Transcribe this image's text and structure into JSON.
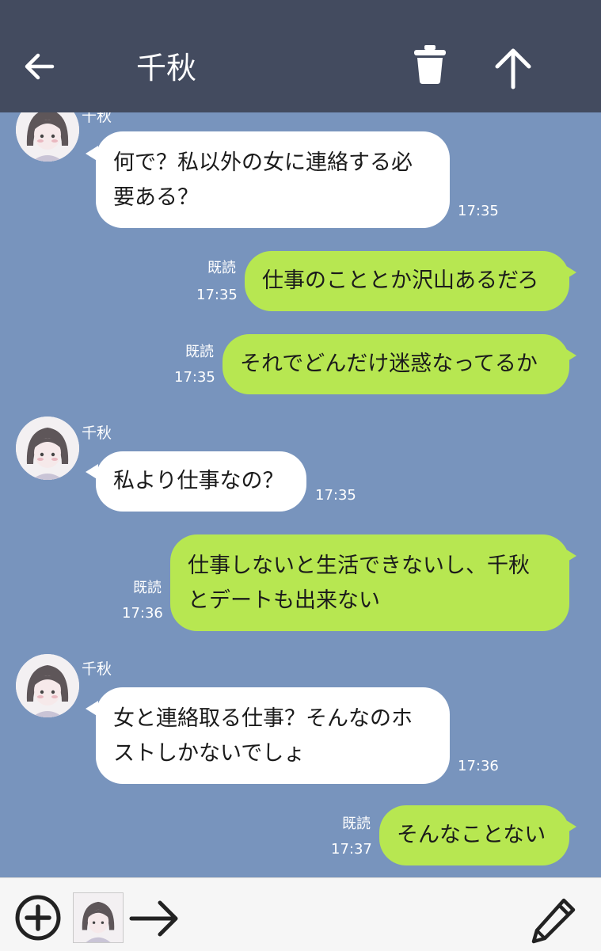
{
  "header": {
    "title": "千秋",
    "background": "#434b5f",
    "icons": [
      "back-arrow-icon",
      "trash-icon",
      "up-arrow-icon"
    ]
  },
  "chat": {
    "background": "#7894bd",
    "outgoing_color": "#b7e751",
    "incoming_color": "#ffffff",
    "messages": [
      {
        "direction": "in",
        "sender": "千秋",
        "text": "何で？私以外の女に連絡する必\n要ある？",
        "time": "17:35"
      },
      {
        "direction": "out",
        "read": "既読",
        "text": "仕事のこととか沢山あるだろ",
        "time": "17:35"
      },
      {
        "direction": "out",
        "read": "既読",
        "text": "それでどんだけ迷惑なってるか",
        "time": "17:35"
      },
      {
        "direction": "in",
        "sender": "千秋",
        "text": "私より仕事なの？",
        "time": "17:35"
      },
      {
        "direction": "out",
        "read": "既読",
        "text": "仕事しないと生活できないし、千秋\nとデートも出来ない",
        "time": "17:36"
      },
      {
        "direction": "in",
        "sender": "千秋",
        "text": "女と連絡取る仕事？そんなのホ\nストしかないでしょ",
        "time": "17:36"
      },
      {
        "direction": "out",
        "read": "既読",
        "text": "そんなことない",
        "time": "17:37"
      }
    ]
  },
  "footer": {
    "icons": [
      "plus-circle-icon",
      "avatar-thumbnail",
      "right-arrow-icon",
      "pencil-icon"
    ]
  }
}
